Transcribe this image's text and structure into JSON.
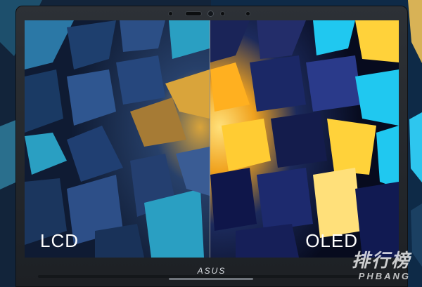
{
  "screen": {
    "left_label": "LCD",
    "right_label": "OLED"
  },
  "bezel": {
    "logo_text": "ASUS"
  },
  "watermark": {
    "main": "排行榜",
    "sub": "PHBANG"
  },
  "colors": {
    "frame": "#25292e",
    "lcd_gold": "#d9a43b",
    "lcd_cyan": "#2a9fc2",
    "oled_gold": "#ffd23a",
    "oled_cyan": "#20c8f0",
    "background": "#0b1626"
  }
}
